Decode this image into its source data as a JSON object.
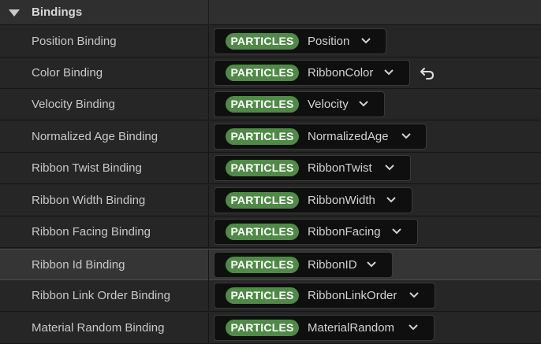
{
  "section": {
    "title": "Bindings"
  },
  "rows": [
    {
      "label": "Position Binding",
      "namespace": "PARTICLES",
      "value": "Position"
    },
    {
      "label": "Color Binding",
      "namespace": "PARTICLES",
      "value": "RibbonColor"
    },
    {
      "label": "Velocity Binding",
      "namespace": "PARTICLES",
      "value": "Velocity"
    },
    {
      "label": "Normalized Age Binding",
      "namespace": "PARTICLES",
      "value": "NormalizedAge"
    },
    {
      "label": "Ribbon Twist Binding",
      "namespace": "PARTICLES",
      "value": "RibbonTwist"
    },
    {
      "label": "Ribbon Width Binding",
      "namespace": "PARTICLES",
      "value": "RibbonWidth"
    },
    {
      "label": "Ribbon Facing Binding",
      "namespace": "PARTICLES",
      "value": "RibbonFacing"
    },
    {
      "label": "Ribbon Id Binding",
      "namespace": "PARTICLES",
      "value": "RibbonID"
    },
    {
      "label": "Ribbon Link Order Binding",
      "namespace": "PARTICLES",
      "value": "RibbonLinkOrder"
    },
    {
      "label": "Material Random Binding",
      "namespace": "PARTICLES",
      "value": "MaterialRandom"
    }
  ],
  "colors": {
    "namespace_pill": "#4f8a46",
    "panel_bg": "#242424",
    "selected_row_bg": "#353535"
  },
  "icons": {
    "collapse": "triangle-down-icon",
    "dropdown": "chevron-down-icon",
    "reset": "reset-to-default-icon"
  }
}
